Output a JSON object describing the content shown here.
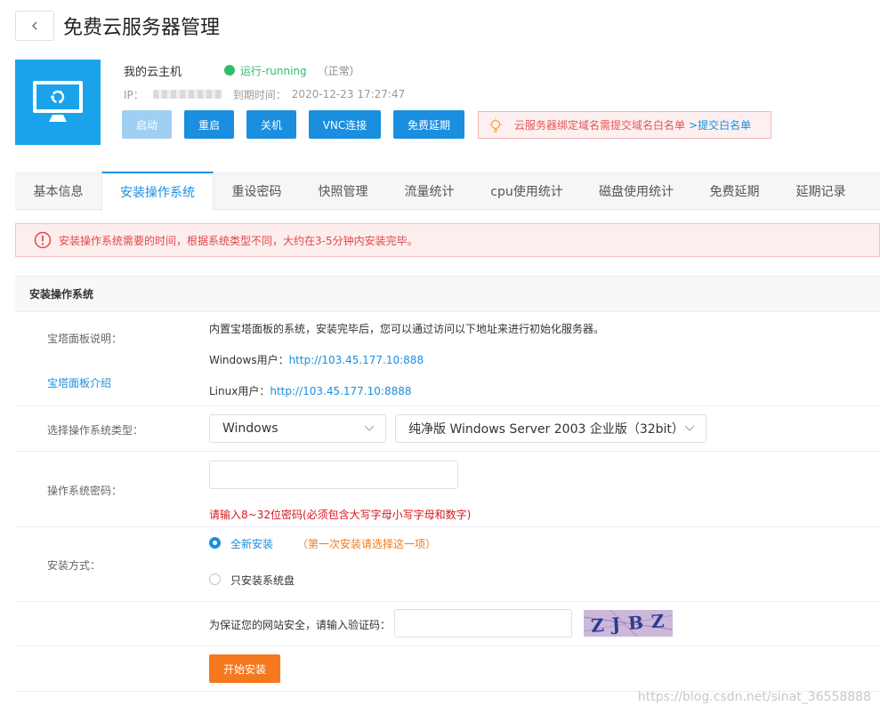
{
  "header": {
    "title": "免费云服务器管理",
    "back_icon": "chevron-left-icon"
  },
  "server": {
    "icon": "monitor-icon",
    "name": "我的云主机",
    "status": "运行-running",
    "status_note": "（正常）",
    "status_color": "#2dbe6c",
    "ip_label": "IP：",
    "expire_label": "到期时间：",
    "expire_value": "2020-12-23 17:27:47"
  },
  "actions": {
    "start": "启动",
    "restart": "重启",
    "shutdown": "关机",
    "vnc": "VNC连接",
    "extend": "免费延期"
  },
  "notice": {
    "text": "云服务器绑定域名需提交域名白名单",
    "link": ">提交白名单"
  },
  "tabs": [
    {
      "label": "基本信息"
    },
    {
      "label": "安装操作系统"
    },
    {
      "label": "重设密码"
    },
    {
      "label": "快照管理"
    },
    {
      "label": "流量统计"
    },
    {
      "label": "cpu使用统计"
    },
    {
      "label": "磁盘使用统计"
    },
    {
      "label": "免费延期"
    },
    {
      "label": "延期记录"
    }
  ],
  "active_tab": 1,
  "alert": {
    "text": "安装操作系统需要的时间，根据系统类型不同，大约在3-5分钟内安装完毕。"
  },
  "panel": {
    "title": "安装操作系统"
  },
  "bt_panel": {
    "label": "宝塔面板说明：",
    "intro_link": "宝塔面板介绍",
    "desc": "内置宝塔面板的系统，安装完毕后，您可以通过访问以下地址来进行初始化服务器。",
    "windows_label": "Windows用户：",
    "windows_url": "http://103.45.177.10:888",
    "linux_label": "Linux用户：",
    "linux_url": "http://103.45.177.10:8888"
  },
  "os_select": {
    "label": "选择操作系统类型：",
    "type_value": "Windows",
    "version_value": "纯净版 Windows Server 2003 企业版（32bit）"
  },
  "password": {
    "label": "操作系统密码：",
    "value": "",
    "hint": "请输入8~32位密码(必须包含大写字母小写字母和数字)"
  },
  "install_mode": {
    "label": "安装方式：",
    "option_full": "全新安装",
    "option_full_note": "（第一次安装请选择这一项）",
    "option_system": "只安装系统盘"
  },
  "captcha": {
    "label": "为保证您的网站安全，请输入验证码：",
    "value": "",
    "image_text": "ZJBZ"
  },
  "submit": {
    "label": "开始安装"
  },
  "watermark": "https://blog.csdn.net/sinat_36558888",
  "colors": {
    "primary": "#1a8fe0",
    "server_bg": "#1aa3ea",
    "danger": "#e04848",
    "orange": "#f5781f"
  }
}
